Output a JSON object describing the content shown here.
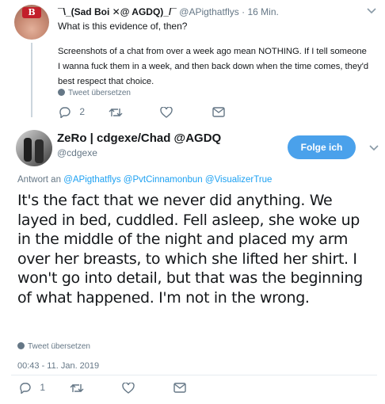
{
  "reply": {
    "name": "¯\\_(Sad Boi ✕@ AGDQ)_/¯",
    "handle": "@APigthatflys",
    "separator": "·",
    "time": "16 Min.",
    "avatar_logo": "B",
    "question": "What is this evidence of, then?",
    "body": "Screenshots of a chat from over a week ago mean NOTHING. If I tell someone I wanna fuck them in a week, and then back down when the time comes, they'd best respect that choice.",
    "translate": "Tweet übersetzen",
    "reply_count": "2"
  },
  "tweet": {
    "name": "ZeRo | cdgexe/Chad @AGDQ",
    "handle": "@cdgexe",
    "follow_label": "Folge ich",
    "reply_to_prefix": "Antwort an",
    "reply_to": [
      "@APigthatflys",
      "@PvtCinnamonbun",
      "@VisualizerTrue"
    ],
    "text": "It's the fact that we never did anything. We layed in bed, cuddled.  Fell asleep, she woke up in the middle of the night and placed my arm over her breasts, to which she lifted her shirt. I won't go into detail, but that was the beginning of what happened. I'm not in the wrong.",
    "translate": "Tweet übersetzen",
    "timestamp": "00:43 - 11. Jan. 2019",
    "reply_count": "1"
  },
  "icons": {
    "chevron": "chevron-down-icon",
    "reply": "reply-icon",
    "retweet": "retweet-icon",
    "like": "heart-icon",
    "message": "envelope-icon",
    "translate": "globe-icon"
  },
  "colors": {
    "accent": "#1da1f2",
    "follow_button": "#4aa1eb",
    "muted": "#657786",
    "text": "#14171a"
  }
}
